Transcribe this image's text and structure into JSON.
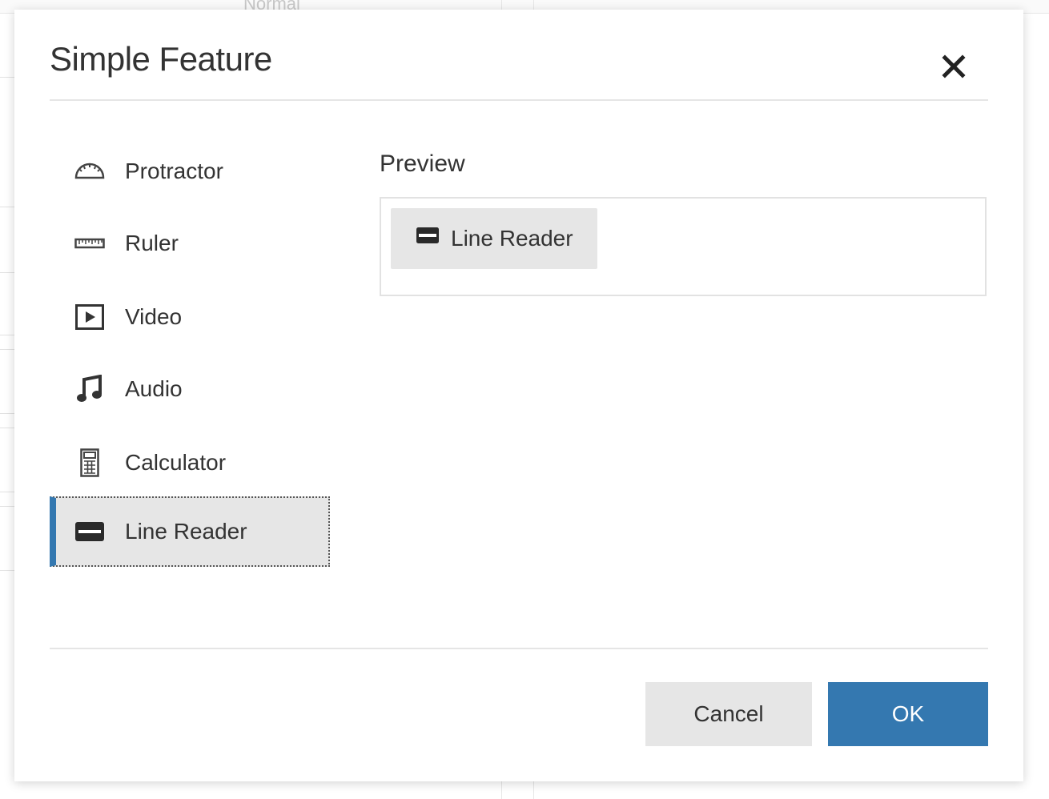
{
  "background": {
    "toolbar_text": "Normal"
  },
  "dialog": {
    "title": "Simple Feature",
    "close_icon": "close-icon"
  },
  "features": [
    {
      "label": "Protractor",
      "icon": "protractor-icon",
      "selected": false
    },
    {
      "label": "Ruler",
      "icon": "ruler-icon",
      "selected": false
    },
    {
      "label": "Video",
      "icon": "video-icon",
      "selected": false
    },
    {
      "label": "Audio",
      "icon": "audio-icon",
      "selected": false
    },
    {
      "label": "Calculator",
      "icon": "calculator-icon",
      "selected": false
    },
    {
      "label": "Line Reader",
      "icon": "line-reader-icon",
      "selected": true
    }
  ],
  "preview": {
    "title": "Preview",
    "button_label": "Line Reader",
    "button_icon": "line-reader-icon"
  },
  "footer": {
    "cancel_label": "Cancel",
    "ok_label": "OK"
  },
  "colors": {
    "primary": "#3478b0",
    "selected_bg": "#e6e6e6",
    "text": "#333333"
  }
}
